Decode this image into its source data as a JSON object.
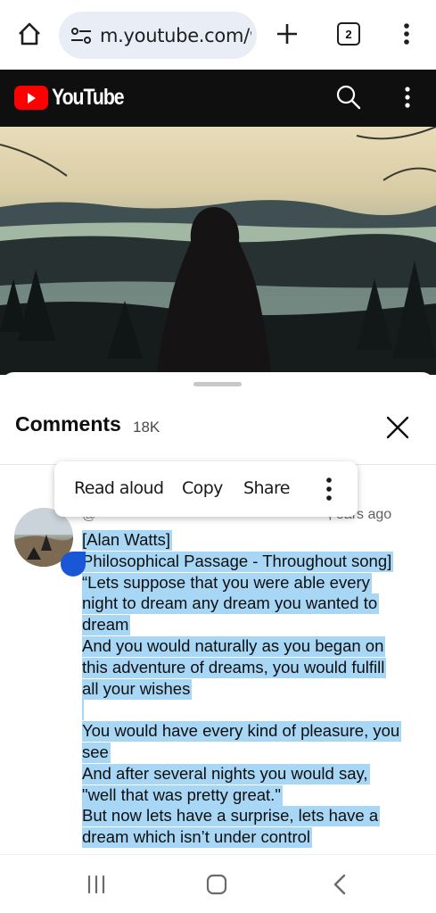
{
  "browser": {
    "url": "m.youtube.com/w",
    "tab_count": "2"
  },
  "youtube": {
    "logo_text": "YouTube"
  },
  "comments": {
    "title": "Comments",
    "count": "18K",
    "items": [
      {
        "author": "@",
        "time": ", ears ago",
        "lines": [
          "[Alan Watts]",
          " Philosophical Passage - Throughout song]",
          "“Lets suppose that you were able every",
          "night to dream any dream you wanted to",
          "dream",
          "And you would naturally as you began on",
          "this adventure of dreams, you would fulfill",
          "all your wishes",
          " ",
          "You would have every kind of pleasure, you",
          "see",
          "And after several nights you would say,",
          "\"well that was pretty great.\"",
          "But now lets have a surprise, lets have a",
          "dream which isn’t under control"
        ]
      }
    ]
  },
  "context_menu": {
    "read_aloud": "Read aloud",
    "copy": "Copy",
    "share": "Share"
  },
  "colors": {
    "selection": "#a8d6f5",
    "youtube_red": "#ff0000",
    "header_bg": "#0f0f0f",
    "selection_handle": "#1a57d6"
  }
}
